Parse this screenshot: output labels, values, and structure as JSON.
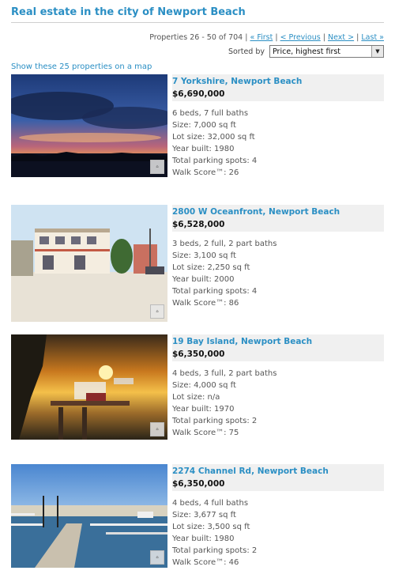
{
  "page": {
    "title": "Real estate in the city of Newport Beach",
    "pager": {
      "range": "Properties 26 - 50 of 704",
      "sep": "|",
      "first": "« First",
      "previous": "< Previous",
      "next": "Next >",
      "last": "Last »"
    },
    "sort": {
      "label": "Sorted by",
      "selected": "Price, highest first"
    },
    "map_link": "Show these 25 properties on a map"
  },
  "listings": [
    {
      "address": "7 Yorkshire, Newport Beach",
      "price": "$6,690,000",
      "beds_baths": "6 beds, 7 full baths",
      "size": "Size: 7,000 sq ft",
      "lot": "Lot size: 32,000 sq ft",
      "year": "Year built: 1980",
      "parking": "Total parking spots: 4",
      "walk": "Walk Score™: 26"
    },
    {
      "address": "2800 W Oceanfront, Newport Beach",
      "price": "$6,528,000",
      "beds_baths": "3 beds, 2 full, 2 part baths",
      "size": "Size: 3,100 sq ft",
      "lot": "Lot size: 2,250 sq ft",
      "year": "Year built: 2000",
      "parking": "Total parking spots: 4",
      "walk": "Walk Score™: 86"
    },
    {
      "address": "19 Bay Island, Newport Beach",
      "price": "$6,350,000",
      "beds_baths": "4 beds, 3 full, 2 part baths",
      "size": "Size: 4,000 sq ft",
      "lot": "Lot size: n/a",
      "year": "Year built: 1970",
      "parking": "Total parking spots: 2",
      "walk": "Walk Score™: 75"
    },
    {
      "address": "2274 Channel Rd, Newport Beach",
      "price": "$6,350,000",
      "beds_baths": "4 beds, 4 full baths",
      "size": "Size: 3,677 sq ft",
      "lot": "Lot size: 3,500 sq ft",
      "year": "Year built: 1980",
      "parking": "Total parking spots: 2",
      "walk": "Walk Score™: 46"
    }
  ],
  "photo_badge_icon": "mls-house-icon"
}
